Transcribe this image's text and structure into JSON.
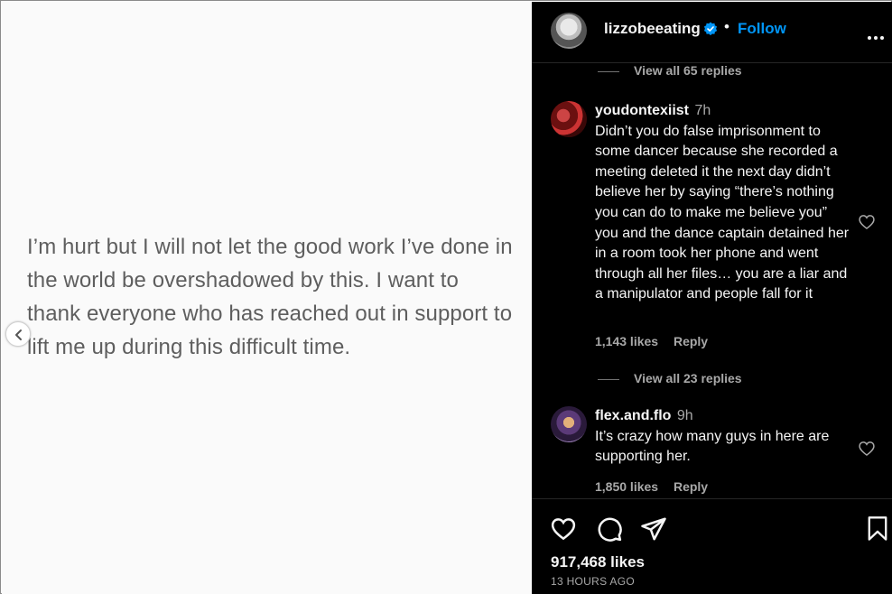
{
  "post": {
    "text": "I’m hurt but I will not let the good work I’ve done in the world be overshadowed by this. I want to thank everyone who has reached out in support to lift me up during this difficult time."
  },
  "header": {
    "username": "lizzobeeating",
    "separator": "•",
    "follow_label": "Follow"
  },
  "replies_top": "View all 65 replies",
  "comments": [
    {
      "username": "youdontexiist",
      "time": "7h",
      "text": "Didn’t you do false imprisonment to some dancer because she recorded a meeting deleted it the next day didn’t believe her by saying “there’s nothing you can do to make me believe you” you and the dance captain detained her in a room took her phone and went through all her files… you are a liar and a manipulator and people fall for it",
      "likes": "1,143 likes",
      "reply": "Reply",
      "replies": "View all 23 replies"
    },
    {
      "username": "flex.and.flo",
      "time": "9h",
      "text": "It’s crazy how many guys in here are supporting her.",
      "likes": "1,850 likes",
      "reply": "Reply"
    }
  ],
  "footer": {
    "likes": "917,468 likes",
    "time_ago": "13 HOURS AGO"
  },
  "colors": {
    "accent": "#0095f6",
    "verified": "#0095f6",
    "muted": "#a8a8a8"
  },
  "icons": [
    "chevron-left-icon",
    "verified-badge-icon",
    "more-icon",
    "heart-icon",
    "comment-icon",
    "share-icon",
    "bookmark-icon"
  ]
}
